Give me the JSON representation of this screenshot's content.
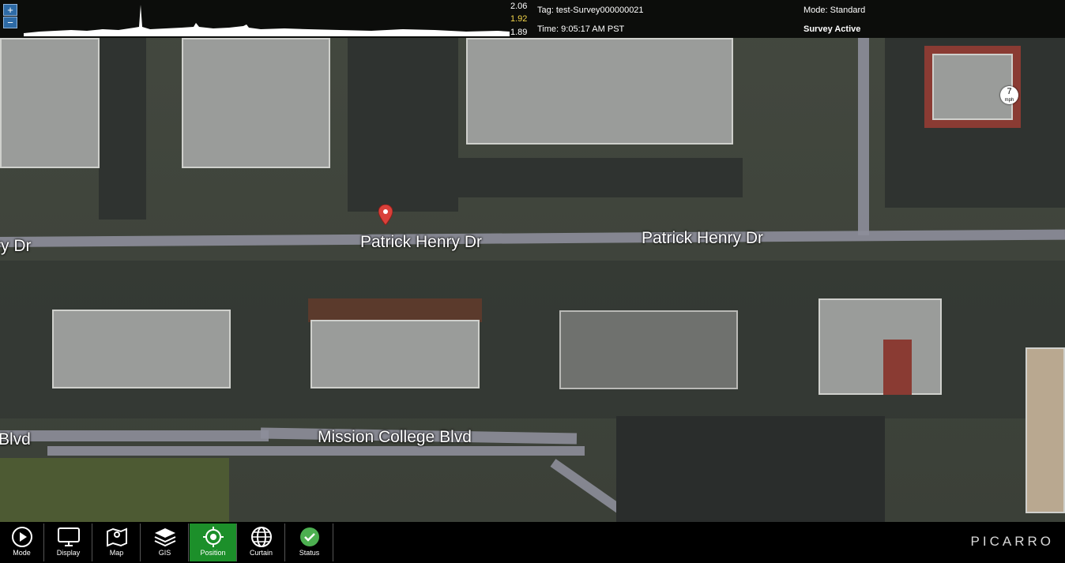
{
  "header": {
    "zoom_in": "+",
    "zoom_out": "−",
    "scale_max": "2.06",
    "scale_mid": "1.92",
    "scale_min": "1.89",
    "tag_label": "Tag:",
    "tag_value": "test-Survey000000021",
    "time_label": "Time:",
    "time_value": "9:05:17 AM PST",
    "mode_label": "Mode:",
    "mode_value": "Standard",
    "survey_status": "Survey Active"
  },
  "map": {
    "roads": [
      "ry Dr",
      "Patrick Henry Dr",
      "Patrick Henry Dr",
      "Blvd",
      "Mission College Blvd"
    ],
    "speed_value": "7",
    "speed_unit": "mph",
    "marker_icon": "location-pin-icon"
  },
  "toolbar": {
    "buttons": [
      {
        "label": "Mode",
        "icon": "mode-play-icon"
      },
      {
        "label": "Display",
        "icon": "monitor-icon"
      },
      {
        "label": "Map",
        "icon": "map-icon"
      },
      {
        "label": "GIS",
        "icon": "layers-icon"
      },
      {
        "label": "Position",
        "icon": "crosshair-icon",
        "active": true
      },
      {
        "label": "Curtain",
        "icon": "globe-icon"
      },
      {
        "label": "Status",
        "icon": "check-circle-icon"
      }
    ],
    "logo": "PICARRO"
  },
  "colors": {
    "active": "#1c8f2a",
    "scale_mid": "#f2d54a",
    "zoom": "#2d6aa6",
    "pin": "#d9403a",
    "status_ok": "#4caf50"
  }
}
